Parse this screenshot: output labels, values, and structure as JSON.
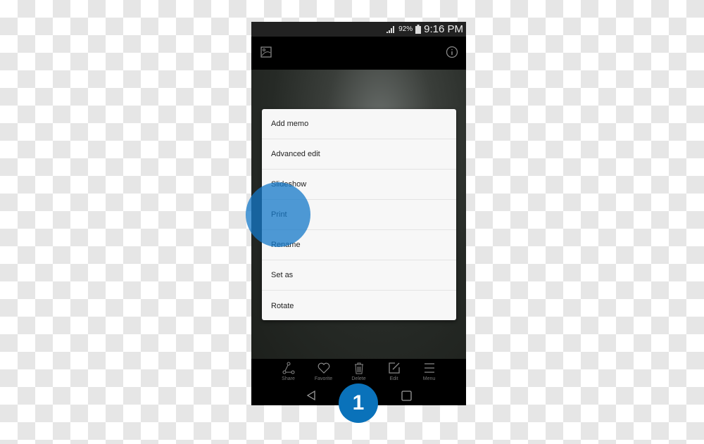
{
  "status": {
    "battery": "92%",
    "time": "9:16 PM"
  },
  "topbar": {
    "left_icon": "gallery-icon",
    "right_icon": "info-icon"
  },
  "menu": {
    "items": [
      {
        "label": "Add memo"
      },
      {
        "label": "Advanced edit"
      },
      {
        "label": "Slideshow"
      },
      {
        "label": "Print"
      },
      {
        "label": "Rename"
      },
      {
        "label": "Set as"
      },
      {
        "label": "Rotate"
      }
    ]
  },
  "actions": [
    {
      "label": "Share",
      "icon": "share-icon"
    },
    {
      "label": "Favorite",
      "icon": "heart-icon"
    },
    {
      "label": "Delete",
      "icon": "trash-icon"
    },
    {
      "label": "Edit",
      "icon": "edit-icon"
    },
    {
      "label": "Menu",
      "icon": "menu-icon"
    }
  ],
  "badge": {
    "step": "1"
  },
  "colors": {
    "accent": "#0a72ba"
  }
}
